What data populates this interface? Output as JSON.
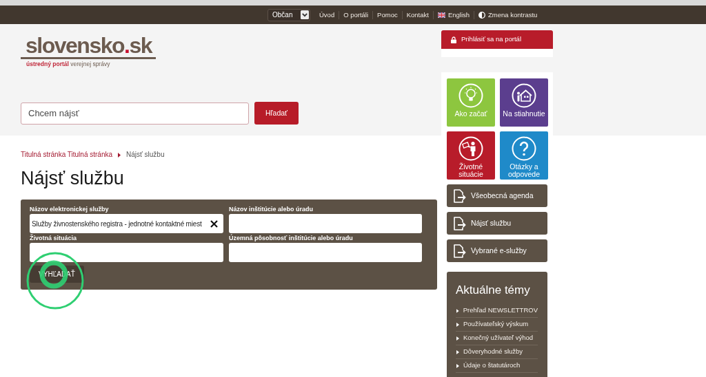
{
  "top_bar": {
    "role_select": {
      "value": "Občan"
    },
    "links": [
      {
        "label": "Úvod",
        "kind": "link"
      },
      {
        "label": "O portáli",
        "kind": "link"
      },
      {
        "label": "Pomoc",
        "kind": "link"
      },
      {
        "label": "Kontakt",
        "kind": "link"
      },
      {
        "label": "English",
        "kind": "language"
      },
      {
        "label": "Zmena kontrastu",
        "kind": "contrast"
      }
    ]
  },
  "header": {
    "logo": "slovensko.sk",
    "tagline": {
      "highlight": "ústredný portál",
      "rest": "verejnej správy"
    },
    "search": {
      "placeholder": "Chcem nájsť",
      "button": "Hľadať"
    }
  },
  "breadcrumb": [
    {
      "label": "Titulná stránka Titulná stránka",
      "current": false
    },
    {
      "label": "Nájsť službu",
      "current": true
    }
  ],
  "title": "Nájsť službu",
  "search_form": {
    "fields": [
      {
        "label": "Názov elektronickej služby",
        "value": "Služby živnostenského registra - jednotné kontaktné miest",
        "clearable": true
      },
      {
        "label": "Názov inštitúcie alebo úradu",
        "clearable": false
      },
      {
        "label": "Životná situácia",
        "clearable": false
      },
      {
        "label": "Územná pôsobnosť inštitúcie alebo úradu",
        "clearable": false
      }
    ],
    "button": "VYHĽADAŤ"
  },
  "right_column": {
    "login": {
      "label": "Prihlásiť sa na portál"
    },
    "tiles": [
      {
        "label": "Ako začať",
        "kind": "bulb",
        "color": "#8dc63f"
      },
      {
        "label": "Na stiahnutie",
        "kind": "house",
        "color": "#5b3e8e"
      },
      {
        "label": "Životné situácie",
        "kind": "person",
        "color": "#b81c2a"
      },
      {
        "label": "Otázky a odpovede",
        "kind": "question",
        "color": "#1f8ac9"
      }
    ],
    "quick_links": [
      {
        "label": "Všeobecná agenda"
      },
      {
        "label": "Nájsť službu"
      },
      {
        "label": "Vybrané e-služby"
      }
    ],
    "topics": {
      "title": "Aktuálne témy",
      "items": [
        "Prehľad NEWSLETTROV",
        "Používateľský výskum",
        "Konečný užívateľ výhod",
        "Dôveryhodné služby",
        "Údaje o štatutároch"
      ]
    }
  }
}
